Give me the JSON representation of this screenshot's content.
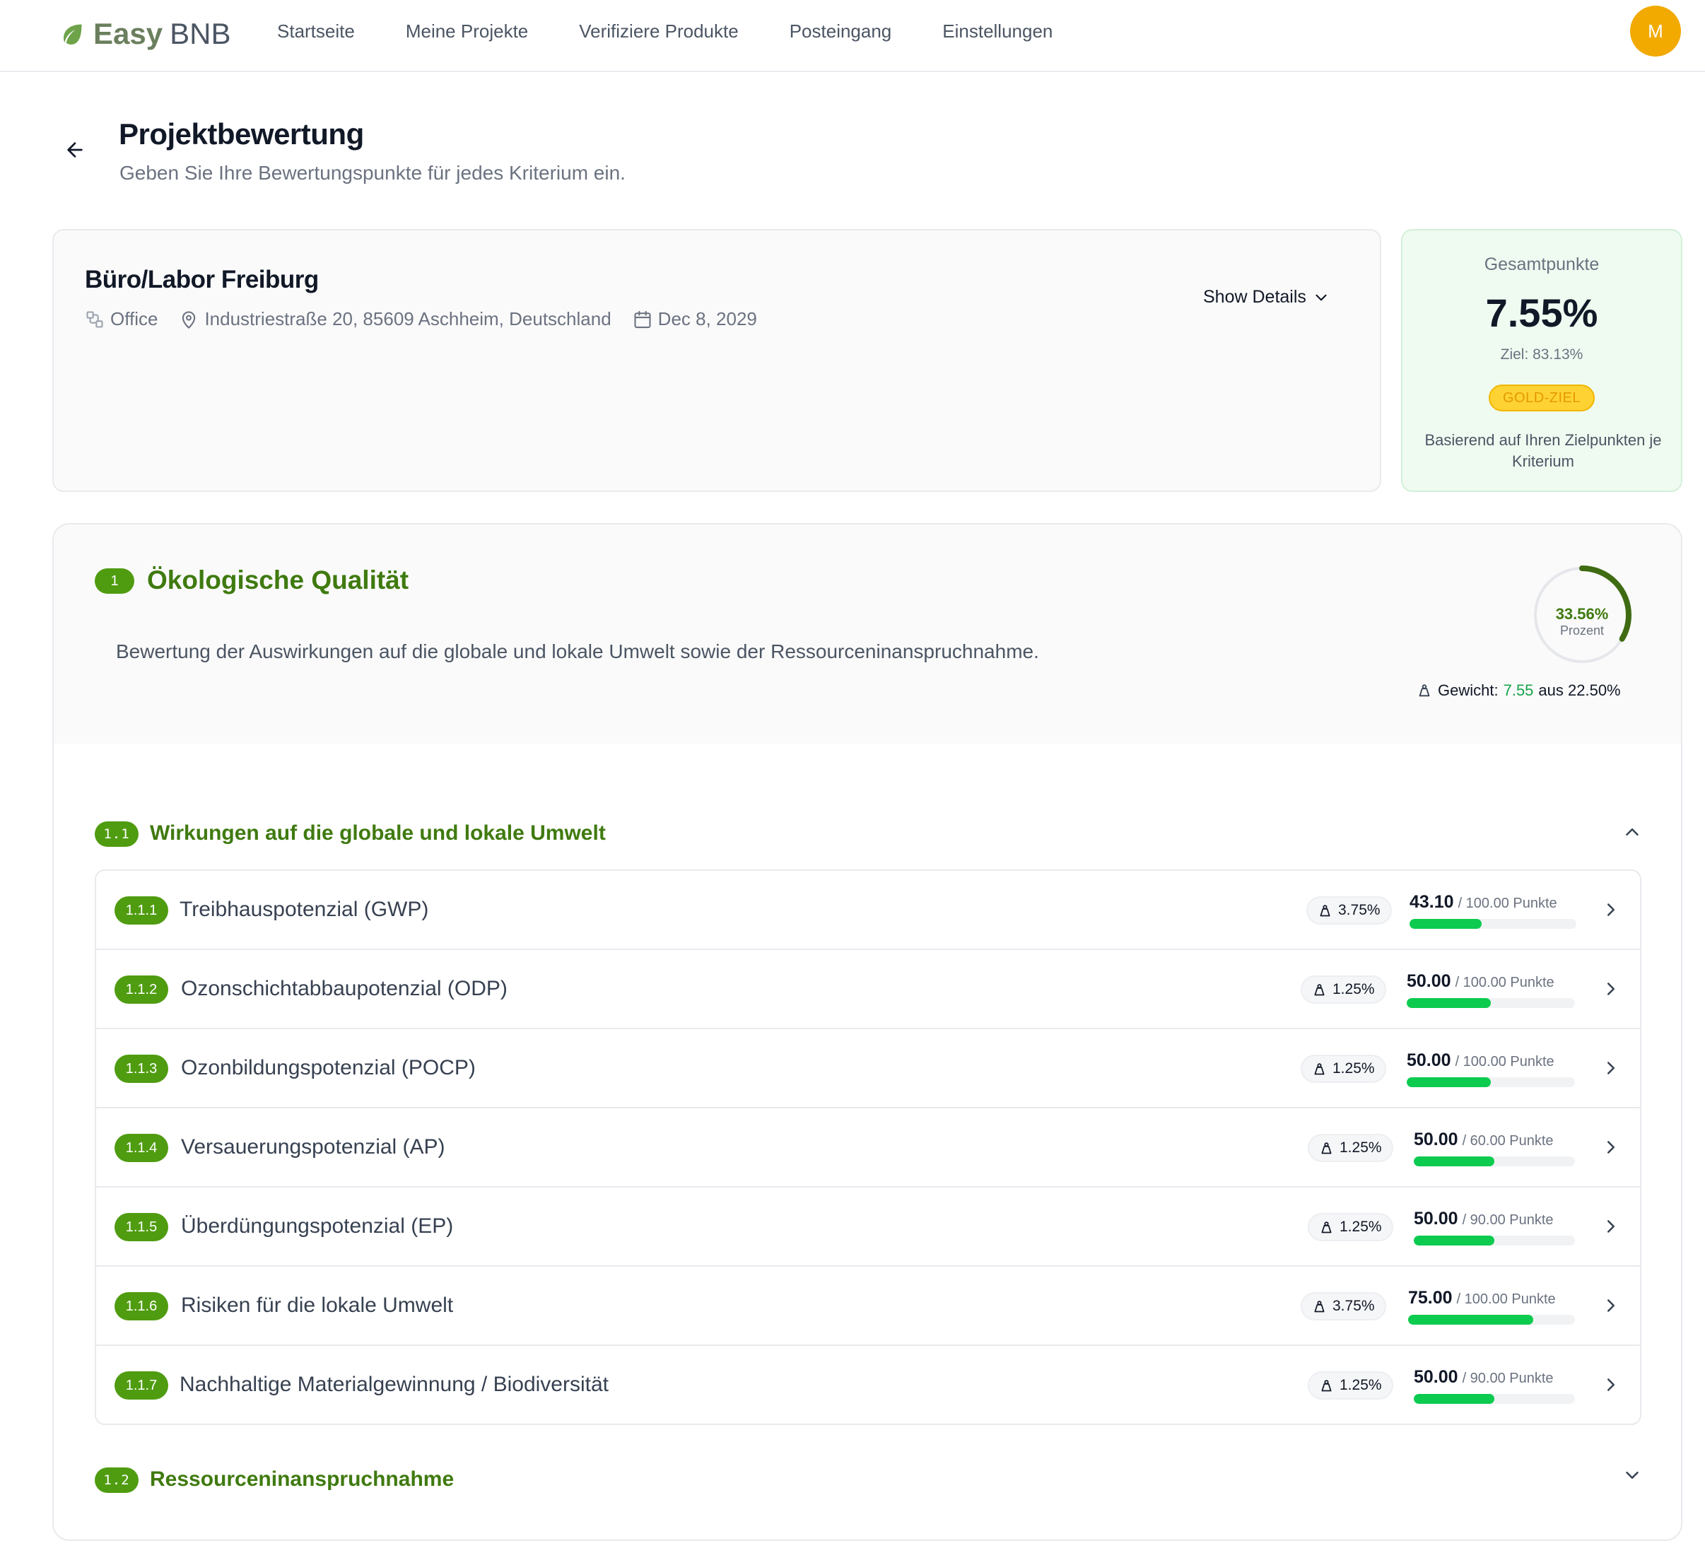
{
  "brand": {
    "name_bold": "Easy",
    "name_regular": "BNB"
  },
  "nav": [
    "Startseite",
    "Meine Projekte",
    "Verifiziere Produkte",
    "Posteingang",
    "Einstellungen"
  ],
  "user": {
    "initial": "M",
    "avatar_color": "#F2A900"
  },
  "page": {
    "title": "Projektbewertung",
    "subtitle": "Geben Sie Ihre Bewertungspunkte für jedes Kriterium ein."
  },
  "project": {
    "name": "Büro/Labor Freiburg",
    "type": "Office",
    "address": "Industriestraße 20, 85609 Aschheim, Deutschland",
    "date": "Dec 8, 2029",
    "details_label": "Show Details"
  },
  "total": {
    "label": "Gesamtpunkte",
    "value": "7.55%",
    "target": "Ziel: 83.13%",
    "badge": "GOLD-ZIEL",
    "note": "Basierend auf Ihren Zielpunkten je Kriterium"
  },
  "category": {
    "number": "1",
    "title": "Ökologische Qualität",
    "description": "Bewertung der Auswirkungen auf die globale und lokale Umwelt sowie der Ressourceninanspruchnahme.",
    "percent_label": "33.56%",
    "percent_value": 33.56,
    "percent_caption": "Prozent",
    "weight_label": "Gewicht:",
    "weight_value": "7.55",
    "weight_suffix": "aus 22.50%"
  },
  "subgroups": [
    {
      "number": "1.1",
      "title": "Wirkungen auf die globale und lokale Umwelt",
      "expanded": true
    },
    {
      "number": "1.2",
      "title": "Ressourceninanspruchnahme",
      "expanded": false
    }
  ],
  "criteria": [
    {
      "number": "1.1.1",
      "name": "Treibhauspotenzial (GWP)",
      "weight": "3.75%",
      "score": "43.10",
      "max": "/ 100.00 Punkte",
      "fraction": 0.431
    },
    {
      "number": "1.1.2",
      "name": "Ozonschichtabbaupotenzial (ODP)",
      "weight": "1.25%",
      "score": "50.00",
      "max": "/ 100.00 Punkte",
      "fraction": 0.5
    },
    {
      "number": "1.1.3",
      "name": "Ozonbildungspotenzial (POCP)",
      "weight": "1.25%",
      "score": "50.00",
      "max": "/ 100.00 Punkte",
      "fraction": 0.5
    },
    {
      "number": "1.1.4",
      "name": "Versauerungspotenzial (AP)",
      "weight": "1.25%",
      "score": "50.00",
      "max": "/ 60.00 Punkte",
      "fraction": 0.5
    },
    {
      "number": "1.1.5",
      "name": "Überdüngungspotenzial (EP)",
      "weight": "1.25%",
      "score": "50.00",
      "max": "/ 90.00 Punkte",
      "fraction": 0.5
    },
    {
      "number": "1.1.6",
      "name": "Risiken für die lokale Umwelt",
      "weight": "3.75%",
      "score": "75.00",
      "max": "/ 100.00 Punkte",
      "fraction": 0.75
    },
    {
      "number": "1.1.7",
      "name": "Nachhaltige Materialgewinnung / Biodiversität",
      "weight": "1.25%",
      "score": "50.00",
      "max": "/ 90.00 Punkte",
      "fraction": 0.5
    }
  ],
  "colors": {
    "primary_green": "#4F9C10",
    "progress_green": "#0CCB4F",
    "gold": "#FFD233"
  }
}
